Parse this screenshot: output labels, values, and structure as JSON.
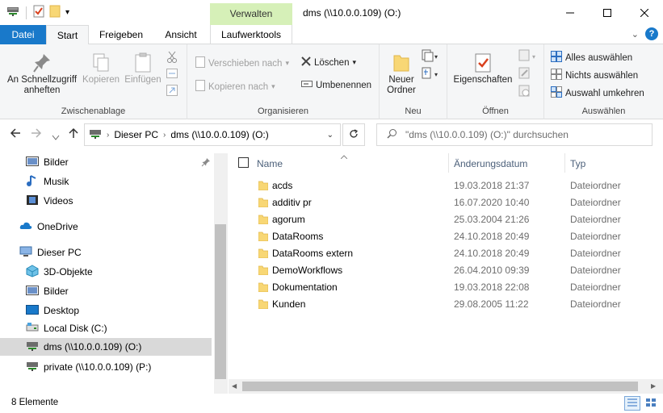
{
  "titlebar": {
    "title": "dms (\\\\10.0.0.109) (O:)",
    "contextual_tab": "Verwalten"
  },
  "tabs": {
    "datei": "Datei",
    "start": "Start",
    "freigeben": "Freigeben",
    "ansicht": "Ansicht",
    "laufwerkstools": "Laufwerktools"
  },
  "ribbon": {
    "zwischenablage": {
      "label": "Zwischenablage",
      "pin": "An Schnellzugriff anheften",
      "copy": "Kopieren",
      "paste": "Einfügen"
    },
    "organisieren": {
      "label": "Organisieren",
      "move_to": "Verschieben nach",
      "copy_to": "Kopieren nach",
      "delete": "Löschen",
      "rename": "Umbenennen"
    },
    "neu": {
      "label": "Neu",
      "new_folder": "Neuer Ordner"
    },
    "oeffnen": {
      "label": "Öffnen",
      "properties": "Eigenschaften"
    },
    "auswaehlen": {
      "label": "Auswählen",
      "select_all": "Alles auswählen",
      "select_none": "Nichts auswählen",
      "invert": "Auswahl umkehren"
    }
  },
  "address": {
    "crumbs": [
      "Dieser PC",
      "dms (\\\\10.0.0.109) (O:)"
    ],
    "search_placeholder": "\"dms (\\\\10.0.0.109) (O:)\" durchsuchen"
  },
  "navpane": {
    "items": [
      {
        "label": "Bilder",
        "icon": "pictures-icon"
      },
      {
        "label": "Musik",
        "icon": "music-icon"
      },
      {
        "label": "Videos",
        "icon": "videos-icon"
      },
      {
        "label": "OneDrive",
        "icon": "onedrive-icon"
      },
      {
        "label": "Dieser PC",
        "icon": "this-pc-icon"
      },
      {
        "label": "3D-Objekte",
        "icon": "3d-objects-icon"
      },
      {
        "label": "Bilder",
        "icon": "pictures-icon"
      },
      {
        "label": "Desktop",
        "icon": "desktop-icon"
      },
      {
        "label": "Local Disk (C:)",
        "icon": "local-disk-icon"
      },
      {
        "label": "dms (\\\\10.0.0.109) (O:)",
        "icon": "network-drive-icon"
      },
      {
        "label": "private (\\\\10.0.0.109) (P:)",
        "icon": "network-drive-icon"
      }
    ]
  },
  "filelist": {
    "columns": {
      "name": "Name",
      "date": "Änderungsdatum",
      "type": "Typ"
    },
    "rows": [
      {
        "name": "acds",
        "date": "19.03.2018 21:37",
        "type": "Dateiordner"
      },
      {
        "name": "additiv pr",
        "date": "16.07.2020 10:40",
        "type": "Dateiordner"
      },
      {
        "name": "agorum",
        "date": "25.03.2004 21:26",
        "type": "Dateiordner"
      },
      {
        "name": "DataRooms",
        "date": "24.10.2018 20:49",
        "type": "Dateiordner"
      },
      {
        "name": "DataRooms extern",
        "date": "24.10.2018 20:49",
        "type": "Dateiordner"
      },
      {
        "name": "DemoWorkflows",
        "date": "26.04.2010 09:39",
        "type": "Dateiordner"
      },
      {
        "name": "Dokumentation",
        "date": "19.03.2018 22:08",
        "type": "Dateiordner"
      },
      {
        "name": "Kunden",
        "date": "29.08.2005 11:22",
        "type": "Dateiordner"
      }
    ]
  },
  "status": {
    "count": "8 Elemente"
  },
  "colors": {
    "accent": "#1979ca",
    "contextual": "#d6f0b8",
    "selection": "#d9d9d9",
    "folder": "#f8d775"
  }
}
